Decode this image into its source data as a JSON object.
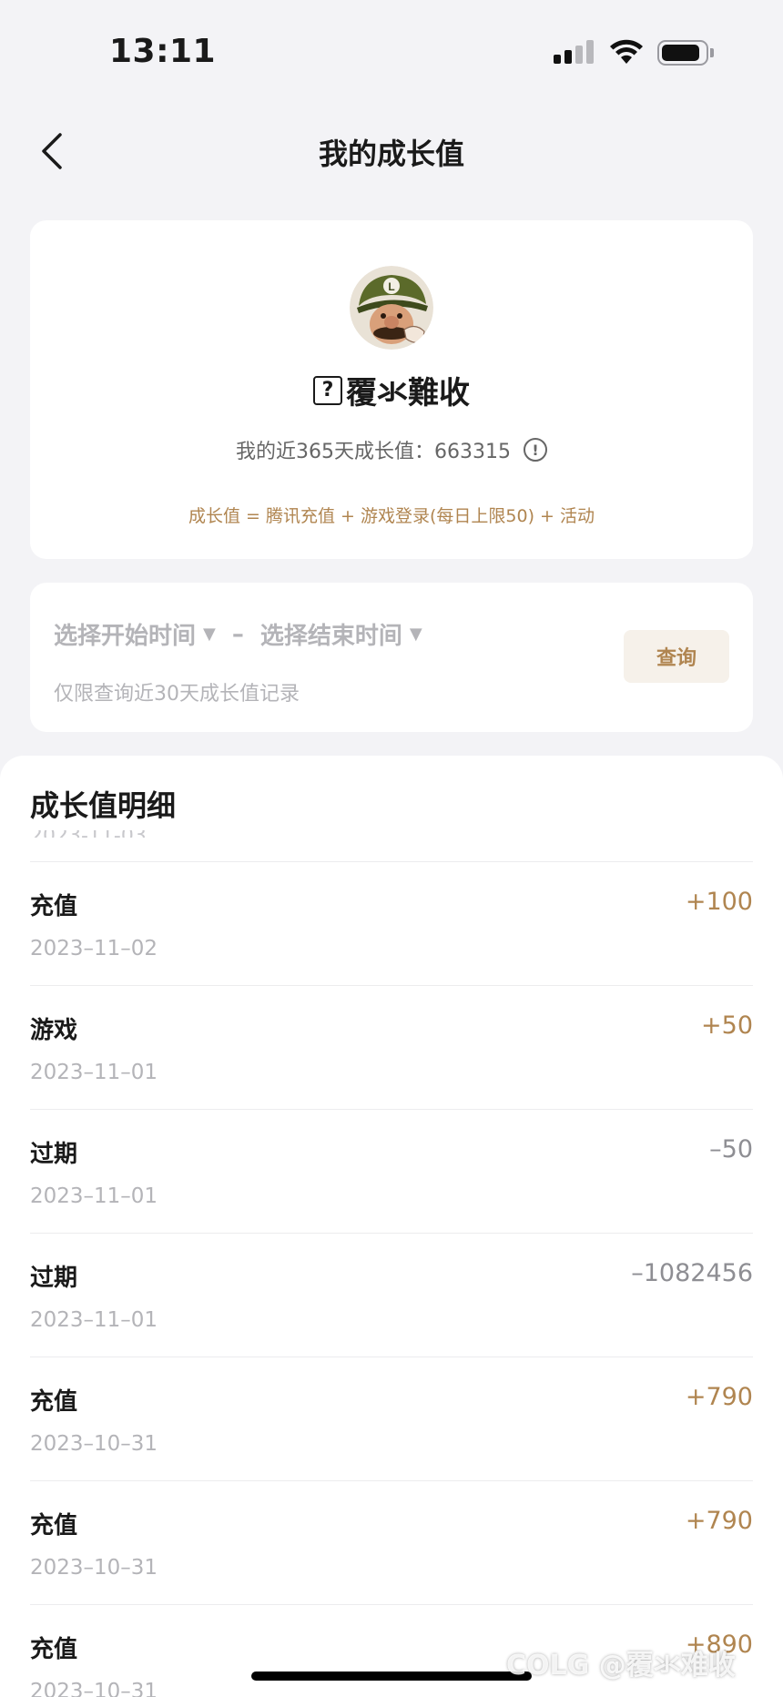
{
  "status_bar": {
    "time": "13:11"
  },
  "nav": {
    "title": "我的成长值"
  },
  "profile": {
    "nickname": "覆氺難收",
    "badge_glyph": "?",
    "growth_label": "我的近365天成长值：663315",
    "formula": "成长值 = 腾讯充值 + 游戏登录(每日上限50) + 活动"
  },
  "query": {
    "start_placeholder": "选择开始时间",
    "end_placeholder": "选择结束时间",
    "separator": "–",
    "hint": "仅限查询近30天成长值记录",
    "button_label": "查询"
  },
  "detail": {
    "title": "成长值明细",
    "records": [
      {
        "type": "充值",
        "date": "2023–11–02",
        "amount": "+100",
        "sign": "pos"
      },
      {
        "type": "游戏",
        "date": "2023–11–01",
        "amount": "+50",
        "sign": "pos"
      },
      {
        "type": "过期",
        "date": "2023–11–01",
        "amount": "–50",
        "sign": "neg"
      },
      {
        "type": "过期",
        "date": "2023–11–01",
        "amount": "–1082456",
        "sign": "neg"
      },
      {
        "type": "充值",
        "date": "2023–10–31",
        "amount": "+790",
        "sign": "pos"
      },
      {
        "type": "充值",
        "date": "2023–10–31",
        "amount": "+790",
        "sign": "pos"
      },
      {
        "type": "充值",
        "date": "2023–10–31",
        "amount": "+890",
        "sign": "pos"
      }
    ]
  },
  "watermark": "COLG @覆氺难收",
  "colors": {
    "accent": "#b08550",
    "muted": "#b4b4b8",
    "negative": "#8e8e93"
  },
  "icons": [
    "back-chevron-icon",
    "signal-icon",
    "wifi-icon",
    "battery-icon",
    "info-icon",
    "caret-down-icon"
  ]
}
